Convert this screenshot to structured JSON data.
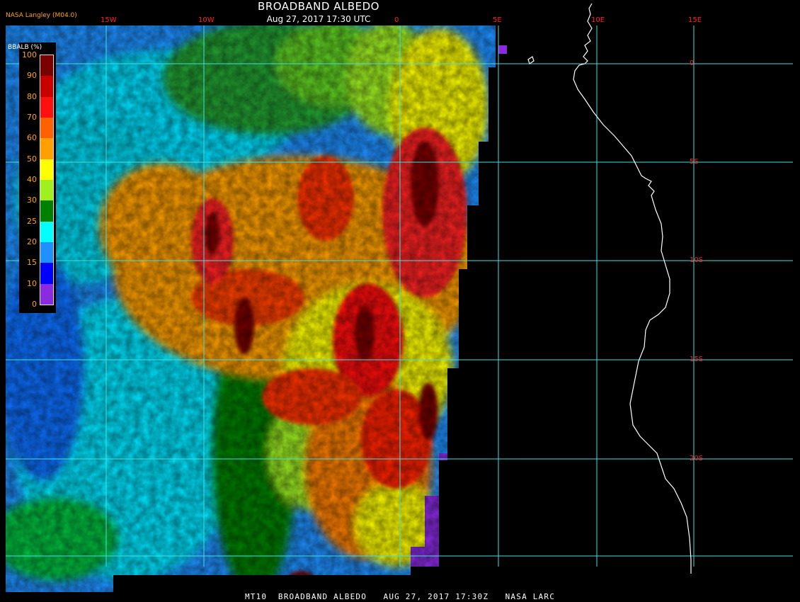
{
  "header": {
    "title": "BROADBAND ALBEDO",
    "subtitle": "Aug 27, 2017 17:30 UTC",
    "source": "NASA Langley (M04.0)"
  },
  "footer": {
    "text": "MT10  BROADBAND ALBEDO   AUG 27, 2017 17:30Z   NASA LARC"
  },
  "legend": {
    "title": "BBALB (%)",
    "ticks": [
      "100",
      "90",
      "80",
      "70",
      "60",
      "50",
      "40",
      "30",
      "25",
      "20",
      "15",
      "10",
      "0"
    ],
    "colors": [
      "#7a0000",
      "#c80000",
      "#ff1010",
      "#ff6000",
      "#ffa000",
      "#ffff00",
      "#a0f020",
      "#008000",
      "#00ffff",
      "#1e90ff",
      "#0000ff",
      "#8a2be2"
    ]
  },
  "grid": {
    "color": "#40e0e0",
    "label_color": "#ff2020",
    "longitudes": [
      {
        "label": "15W"
      },
      {
        "label": "10W"
      },
      {
        "label": "0"
      },
      {
        "label": "5E"
      },
      {
        "label": "10E"
      },
      {
        "label": "15E"
      }
    ],
    "latitudes": [
      {
        "label": "0"
      },
      {
        "label": "5S"
      },
      {
        "label": "10S"
      },
      {
        "label": "15S"
      },
      {
        "label": "20S"
      }
    ]
  },
  "colors": {
    "coastline": "#ffffff",
    "background": "#000000"
  }
}
